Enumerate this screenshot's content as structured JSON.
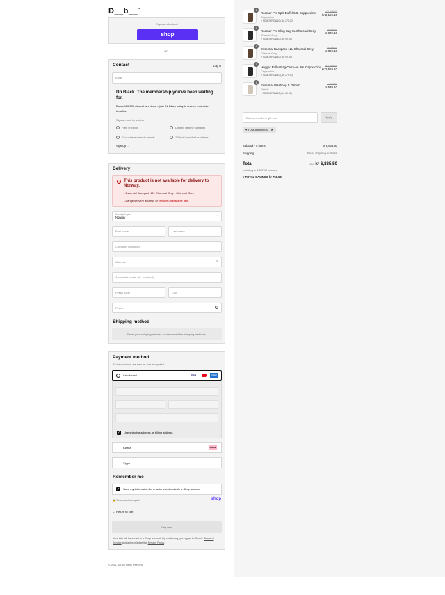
{
  "header": {
    "logo": "D__b__",
    "logo_tm": "™"
  },
  "express": {
    "label": "Express checkout",
    "shop_button": "shop",
    "or": "OR"
  },
  "contact": {
    "title": "Contact",
    "login": "Log in",
    "email_placeholder": "Email",
    "membership_title": "Db Black. The membership you've been waiting for.",
    "membership_text": "Do as 400,000 others have done – join Db Black today to receive exclusive benefits.",
    "signup_prompt": "Sign up now to receive",
    "benefits": [
      "Free shipping",
      "Limited lifetime warranty",
      "Exclusive access to events",
      "10% off your first purchase"
    ],
    "signup_link": "Sign Up"
  },
  "delivery": {
    "title": "Delivery",
    "error_title": "This product is not available for delivery to Norway.",
    "error_item": "Essential Backpack 12L Charcoal Grey / Charcoal Grey",
    "error_change_prefix": "Change delivery address or ",
    "error_remove_link": "remove unavailable item",
    "country_label": "Country/Region",
    "country_value": "Norway",
    "first_name": "First name",
    "last_name": "Last name",
    "company": "Company (optional)",
    "address": "Address",
    "apartment": "Apartment, suite, etc. (optional)",
    "postal": "Postal code",
    "city": "City",
    "phone": "Phone"
  },
  "shipping": {
    "title": "Shipping method",
    "message": "Enter your shipping address to view available shipping methods."
  },
  "payment": {
    "title": "Payment method",
    "subtitle": "All transactions are secure and encrypted.",
    "credit_card": "Credit card",
    "card_badges": [
      "VISA",
      "MC",
      "AMEX"
    ],
    "billing_same": "Use shipping address as billing address",
    "klarna": "Klarna",
    "klarna_badge": "Klarna",
    "vipps": "Vipps"
  },
  "remember": {
    "title": "Remember me",
    "save_info": "Save my information for a faster checkout with a Shop account",
    "secure": "Secure and encrypted",
    "shop_logo": "shop"
  },
  "actions": {
    "return": "Return to cart",
    "pay_now": "Pay now",
    "legal_1": "Your info will be saved to a Shop account. By continuing, you agree to Shop's",
    "terms": "Terms of Service",
    "legal_2": " and acknowledge the ",
    "privacy": "Privacy Policy",
    "legal_3": "."
  },
  "footer": {
    "copyright": "© 2021, Db. All rights reserved."
  },
  "cart": {
    "items": [
      {
        "qty": "1",
        "name": "Roamer Pro Split Duffel 50L Cappuccino",
        "variant": "Cappuccino",
        "discount": "TOMORROW10 (–kr 270.00)",
        "old_price": "kr 2,999.00",
        "price": "kr 2,159.10"
      },
      {
        "qty": "1",
        "name": "Roamer Pro Sling Bag 6L Charcoal Grey",
        "variant": "Charcoal Grey",
        "discount": "TOMORROW10 (–kr 90.00)",
        "old_price": "kr 899.00",
        "price": "kr 809.10"
      },
      {
        "qty": "1",
        "name": "Essential Backpack 12L Charcoal Grey",
        "variant": "Charcoal Grey",
        "discount": "TOMORROW10 (–kr 90.00)",
        "old_price": "kr 899.00",
        "price": "kr 809.10"
      },
      {
        "qty": "1",
        "name": "Hugger Roller Bag Carry-on 40L Cappuccino",
        "variant": "Cappuccino",
        "discount": "TOMORROW10 (–kr 279.90)",
        "old_price": "kr 2,799.00",
        "price": "kr 2,519.10"
      },
      {
        "qty": "1",
        "name": "Essential Washbag S Ostrich",
        "variant": "Ostrich",
        "discount": "TOMORROW10 (–kr 60.00)",
        "old_price": "kr 599.00",
        "price": "kr 539.10"
      }
    ],
    "discount_placeholder": "Discount code or gift card",
    "apply": "Apply",
    "applied_code": "TOMORROW10",
    "subtotal_label": "Subtotal · 5 items",
    "subtotal_value": "kr 6,835.50",
    "shipping_label": "Shipping",
    "shipping_value": "Enter shipping address",
    "total_label": "Total",
    "currency": "NOK",
    "total_value": "kr 6,835.50",
    "taxes": "Including kr 1,367.10 in taxes",
    "savings_label": "TOTAL SAVINGS",
    "savings_value": "kr 759.50"
  }
}
